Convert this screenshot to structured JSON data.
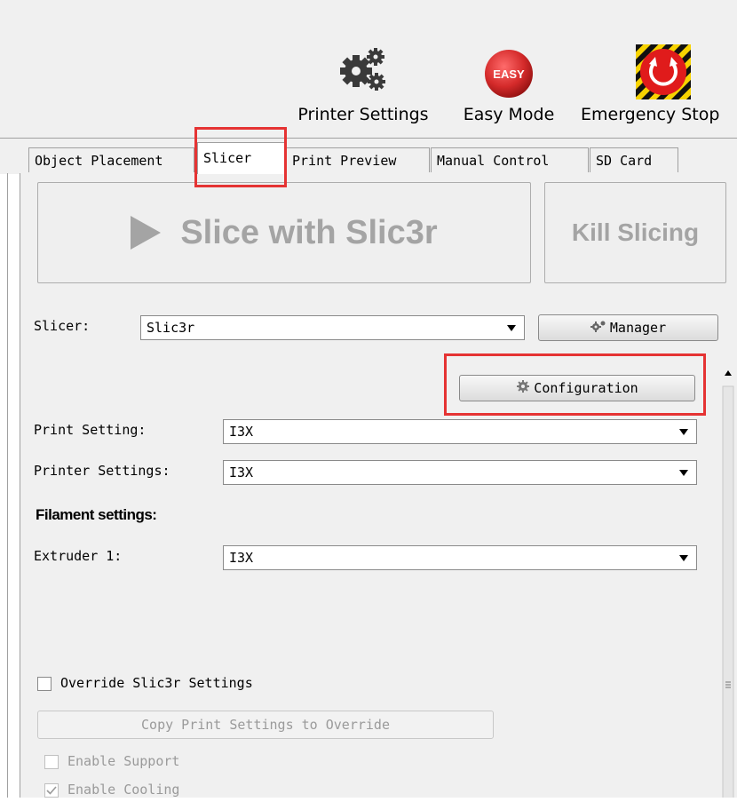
{
  "toolbar": {
    "printer_settings_label": "Printer Settings",
    "easy_mode_label": "Easy Mode",
    "easy_mode_icon_text": "EASY",
    "emergency_stop_label": "Emergency Stop"
  },
  "tabs": [
    {
      "label": "Object Placement"
    },
    {
      "label": "Slicer"
    },
    {
      "label": "Print Preview"
    },
    {
      "label": "Manual Control"
    },
    {
      "label": "SD Card"
    }
  ],
  "active_tab": "Slicer",
  "slice_button_label": "Slice with Slic3r",
  "kill_button_label": "Kill Slicing",
  "slicer": {
    "label": "Slicer:",
    "value": "Slic3r",
    "manager_label": "Manager"
  },
  "configuration_label": "Configuration",
  "print_setting": {
    "label": "Print Setting:",
    "value": "I3X"
  },
  "printer_settings": {
    "label": "Printer Settings:",
    "value": "I3X"
  },
  "filament_heading": "Filament settings:",
  "extruder1": {
    "label": "Extruder 1:",
    "value": "I3X"
  },
  "override": {
    "label": "Override Slic3r Settings",
    "checked": false
  },
  "copy_button_label": "Copy Print Settings to Override",
  "enable_support": {
    "label": "Enable Support",
    "checked": false
  },
  "enable_cooling": {
    "label": "Enable Cooling",
    "checked": true
  },
  "colors": {
    "highlight": "#e53333",
    "easy_red": "#d42a2a",
    "panel": "#f0f0f0"
  }
}
